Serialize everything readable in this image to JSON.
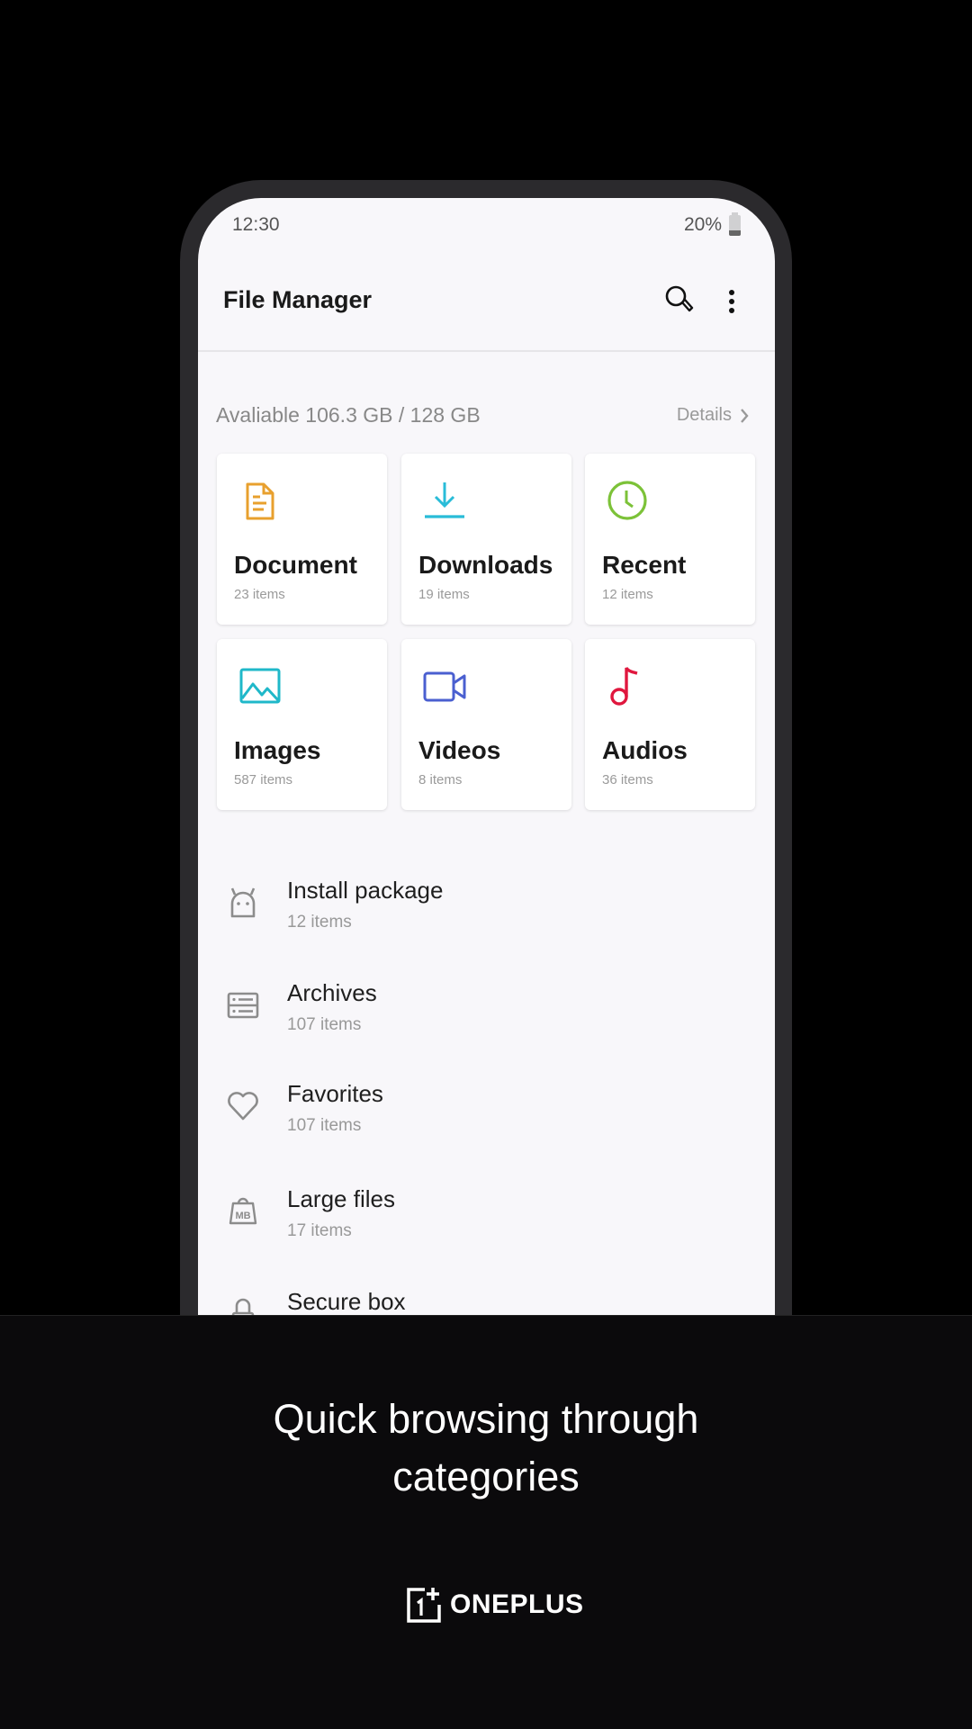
{
  "status_bar": {
    "time": "12:30",
    "battery": "20%"
  },
  "app_bar": {
    "title": "File Manager",
    "search_icon": "search-icon",
    "menu_icon": "more-vertical-icon"
  },
  "storage": {
    "text": "Avaliable 106.3 GB / 128 GB",
    "details_label": "Details"
  },
  "categories": [
    {
      "name": "Document",
      "count": "23 items",
      "icon": "document-icon",
      "color": "#e8a02e"
    },
    {
      "name": "Downloads",
      "count": "19 items",
      "icon": "download-icon",
      "color": "#29bcd8"
    },
    {
      "name": "Recent",
      "count": "12 items",
      "icon": "clock-icon",
      "color": "#7cc238"
    },
    {
      "name": "Images",
      "count": "587 items",
      "icon": "image-icon",
      "color": "#1fb8c9"
    },
    {
      "name": "Videos",
      "count": "8 items",
      "icon": "video-icon",
      "color": "#4a5fd0"
    },
    {
      "name": "Audios",
      "count": "36 items",
      "icon": "music-note-icon",
      "color": "#e0173e"
    }
  ],
  "list": [
    {
      "name": "Install package",
      "count": "12 items",
      "icon": "android-icon"
    },
    {
      "name": "Archives",
      "count": "107 items",
      "icon": "archive-icon"
    },
    {
      "name": "Favorites",
      "count": "107 items",
      "icon": "heart-icon"
    },
    {
      "name": "Large files",
      "count": "17 items",
      "icon": "large-file-icon"
    },
    {
      "name": "Secure box",
      "count": "",
      "icon": "lock-icon"
    }
  ],
  "promo": {
    "caption_line1": "Quick browsing through",
    "caption_line2": "categories",
    "brand": "ONEPLUS"
  }
}
